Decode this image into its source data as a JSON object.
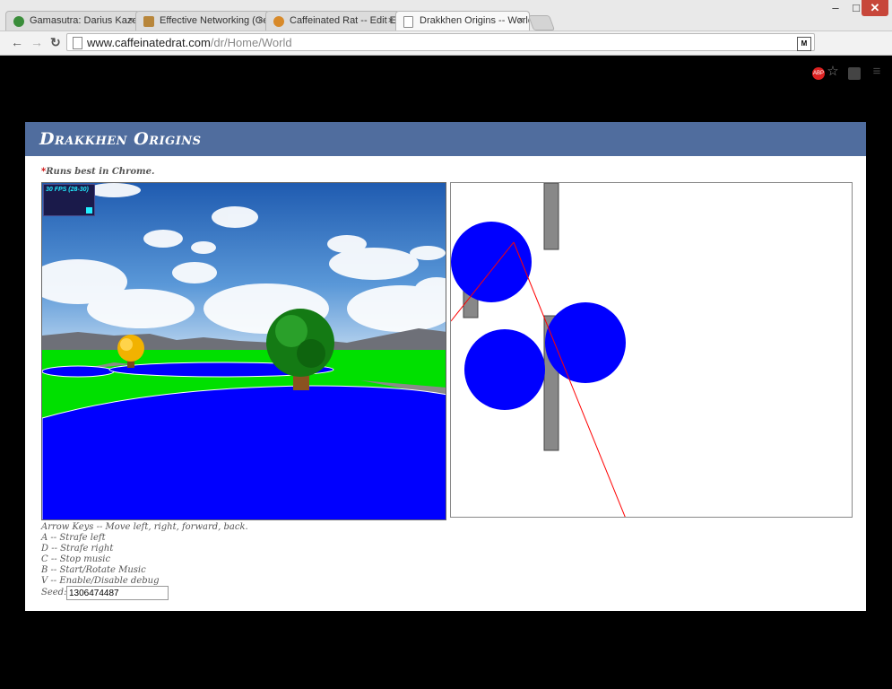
{
  "browser": {
    "tabs": [
      {
        "label": "Gamasutra: Darius Kazemi",
        "icon_color": "#3a8d3a"
      },
      {
        "label": "Effective Networking (Get",
        "icon_color": "#b8863b"
      },
      {
        "label": "Caffeinated Rat -- Edit Exp",
        "icon_color": "#d88a2a"
      },
      {
        "label": "Drakkhen Origins -- World",
        "icon_color": "#ffffff"
      }
    ],
    "close_glyph": "×",
    "url_host": "www.caffeinatedrat.com",
    "url_path": "/dr/Home/World",
    "icons": [
      "back-icon",
      "forward-icon",
      "reload-icon",
      "page-icon",
      "extension-icon",
      "adblock-icon",
      "star-icon",
      "extension2-icon",
      "menu-icon"
    ],
    "window_controls": {
      "minimize": "–",
      "maximize": "□",
      "close": "✕"
    }
  },
  "page": {
    "title": "Drakkhen Origins",
    "note_star": "*",
    "note": "Runs best in Chrome.",
    "fps": "30 FPS (28-30)",
    "instructions": [
      "Arrow Keys -- Move left, right, forward, back.",
      "A -- Strafe left",
      "D -- Strafe right",
      "C -- Stop music",
      "B -- Start/Rotate Music",
      "V -- Enable/Disable debug"
    ],
    "seed_label": "Seed:",
    "seed_value": "1306474487"
  },
  "colors": {
    "banner": "#506d9e",
    "water": "#0000ff",
    "grass": "#00e000",
    "sky": "#3a78c8",
    "map_circle": "#0000ff",
    "map_wall": "#888888",
    "ray": "#ff0000"
  }
}
